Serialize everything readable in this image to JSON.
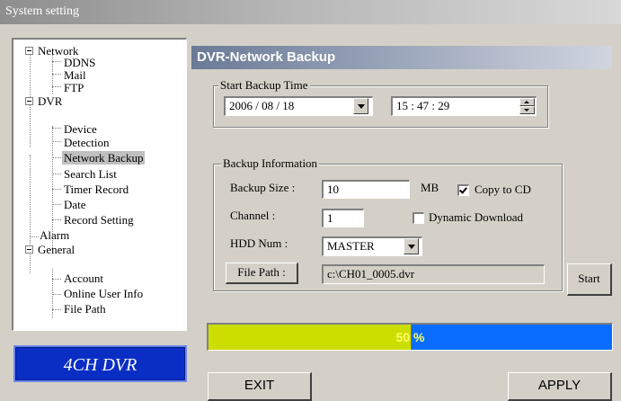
{
  "window": {
    "title": "System setting"
  },
  "tree": {
    "network": "Network",
    "ddns": "DDNS",
    "mail": "Mail",
    "ftp": "FTP",
    "dvr": "DVR",
    "device": "Device",
    "detection": "Detection",
    "network_backup": "Network Backup",
    "search_list": "Search List",
    "timer_record": "Timer Record",
    "date": "Date",
    "record_setting": "Record Setting",
    "alarm": "Alarm",
    "general": "General",
    "account": "Account",
    "online_user_info": "Online User Info",
    "file_path": "File Path"
  },
  "logo": "4CH DVR",
  "panel": {
    "title": "DVR-Network Backup"
  },
  "start_backup": {
    "label": "Start Backup Time",
    "date": "2006 / 08 / 18",
    "time": "15 : 47 : 29"
  },
  "backup_info": {
    "label": "Backup Information",
    "size_label": "Backup Size :",
    "size_value": "10",
    "size_unit": "MB",
    "copy_cd_label": "Copy to CD",
    "copy_cd_checked": true,
    "channel_label": "Channel :",
    "channel_value": "1",
    "dynamic_label": "Dynamic Download",
    "dynamic_checked": false,
    "hdd_label": "HDD Num :",
    "hdd_value": "MASTER",
    "file_path_button": "File Path :",
    "file_path_value": "c:\\CH01_0005.dvr"
  },
  "start_button": "Start",
  "progress": {
    "percent": 50,
    "label": "50 %",
    "fill_color": "#ccdd00",
    "track_color": "#0a6dff"
  },
  "buttons": {
    "exit": "EXIT",
    "apply": "APPLY"
  }
}
